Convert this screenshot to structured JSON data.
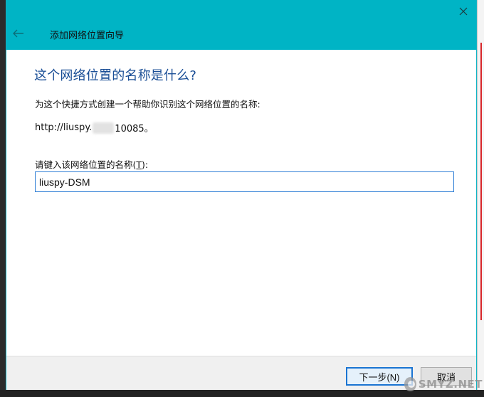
{
  "window": {
    "title": "添加网络位置向导",
    "back_icon": "arrow-left-icon",
    "close_icon": "close-icon"
  },
  "page": {
    "heading": "这个网络位置的名称是什么?",
    "instruction": "为这个快捷方式创建一个帮助你识别这个网络位置的名称:",
    "address_prefix": "http://liuspy.",
    "address_suffix": "10085。",
    "name_label_prefix": "请键入该网络位置的名称(",
    "name_label_hotkey": "T",
    "name_label_suffix": "):",
    "name_value": "liuspy-DSM"
  },
  "footer": {
    "next_label": "下一步(N)",
    "cancel_label": "取消"
  },
  "watermark": {
    "text": "SMYZ.NET"
  },
  "colors": {
    "titlebar": "#00b4c5",
    "heading": "#1a4e96",
    "input_border": "#2f7fd6",
    "default_button_border": "#1a74d2"
  }
}
